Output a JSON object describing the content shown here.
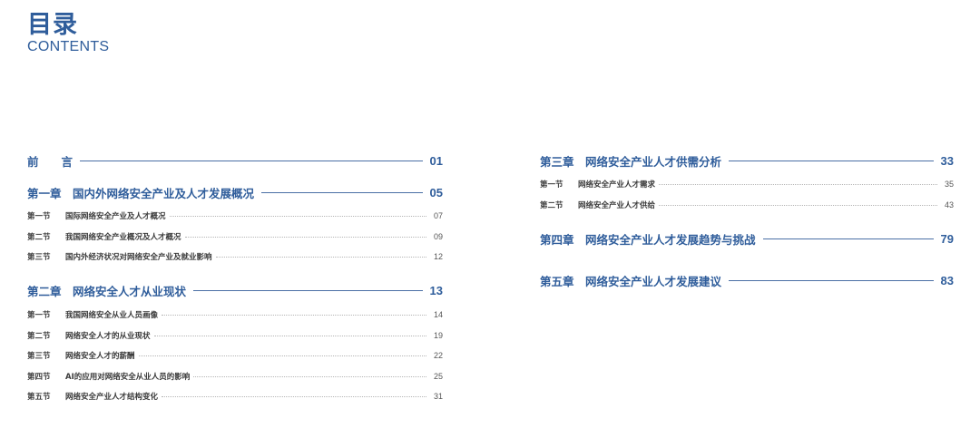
{
  "header": {
    "title": "目录",
    "subtitle": "CONTENTS"
  },
  "left": {
    "preface": {
      "label": "前　　言",
      "page": "01"
    },
    "ch1": {
      "label": "第一章　国内外网络安全产业及人才发展概况",
      "page": "05",
      "sections": [
        {
          "no": "第一节",
          "title": "国际网络安全产业及人才概况",
          "page": "07"
        },
        {
          "no": "第二节",
          "title": "我国网络安全产业概况及人才概况",
          "page": "09"
        },
        {
          "no": "第三节",
          "title": "国内外经济状况对网络安全产业及就业影响",
          "page": "12"
        }
      ]
    },
    "ch2": {
      "label": "第二章　网络安全人才从业现状",
      "page": "13",
      "sections": [
        {
          "no": "第一节",
          "title": "我国网络安全从业人员画像",
          "page": "14"
        },
        {
          "no": "第二节",
          "title": "网络安全人才的从业现状",
          "page": "19"
        },
        {
          "no": "第三节",
          "title": "网络安全人才的薪酬",
          "page": "22"
        },
        {
          "no": "第四节",
          "title": "AI的应用对网络安全从业人员的影响",
          "page": "25"
        },
        {
          "no": "第五节",
          "title": "网络安全产业人才结构变化",
          "page": "31"
        }
      ]
    }
  },
  "right": {
    "ch3": {
      "label": "第三章　网络安全产业人才供需分析",
      "page": "33",
      "sections": [
        {
          "no": "第一节",
          "title": "网络安全产业人才需求",
          "page": "35"
        },
        {
          "no": "第二节",
          "title": "网络安全产业人才供给",
          "page": "43"
        }
      ]
    },
    "ch4": {
      "label": "第四章　网络安全产业人才发展趋势与挑战",
      "page": "79"
    },
    "ch5": {
      "label": "第五章　网络安全产业人才发展建议",
      "page": "83"
    }
  }
}
